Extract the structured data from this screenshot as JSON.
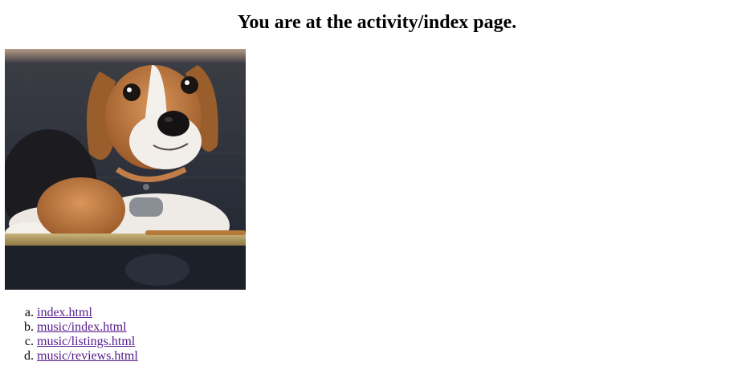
{
  "page": {
    "heading": "You are at the activity/index page."
  },
  "image": {
    "subject": "beagle-dog-photo"
  },
  "links": [
    {
      "label": "index.html"
    },
    {
      "label": "music/index.html"
    },
    {
      "label": "music/listings.html"
    },
    {
      "label": "music/reviews.html"
    }
  ],
  "colors": {
    "visited_link": "#551a8b",
    "text": "#000000",
    "background": "#ffffff"
  }
}
